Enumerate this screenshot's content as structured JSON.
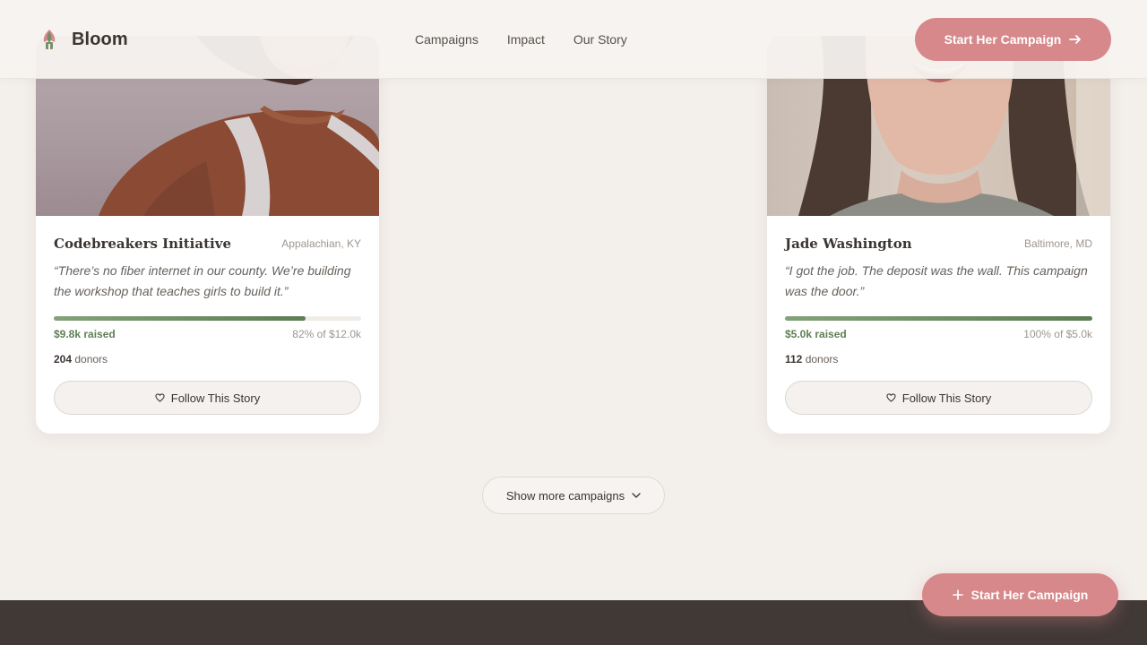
{
  "brand": {
    "name": "Bloom",
    "icon": "bloom-logo-icon"
  },
  "nav": [
    {
      "label": "Campaigns"
    },
    {
      "label": "Impact"
    },
    {
      "label": "Our Story"
    }
  ],
  "header_cta": {
    "label": "Start Her Campaign",
    "icon": "arrow-right-icon"
  },
  "campaigns": [
    {
      "title": "Codebreakers Initiative",
      "location": "Appalachian, KY",
      "quote": "“There’s no fiber internet in our county. We’re building the workshop that teaches girls to build it.”",
      "raised": "$9.8k raised",
      "progress_percent": 82,
      "progress_text": "82% of $12.0k",
      "donors_count": "204",
      "donors_label": " donors",
      "follow_label": "Follow This Story",
      "follow_icon": "heart-icon"
    },
    {
      "title": "Jade Washington",
      "location": "Baltimore, MD",
      "quote": "“I got the job. The deposit was the wall. This campaign was the door.”",
      "raised": "$5.0k raised",
      "progress_percent": 100,
      "progress_text": "100% of $5.0k",
      "donors_count": "112",
      "donors_label": " donors",
      "follow_label": "Follow This Story",
      "follow_icon": "heart-icon"
    }
  ],
  "show_more": {
    "label": "Show more campaigns",
    "icon": "chevron-down-icon"
  },
  "floating_cta": {
    "label": "Start Her Campaign",
    "icon": "plus-icon"
  },
  "colors": {
    "accent": "#d6888a",
    "progress": "#5e7d55",
    "background": "#f3efeb",
    "footer": "#413936"
  }
}
